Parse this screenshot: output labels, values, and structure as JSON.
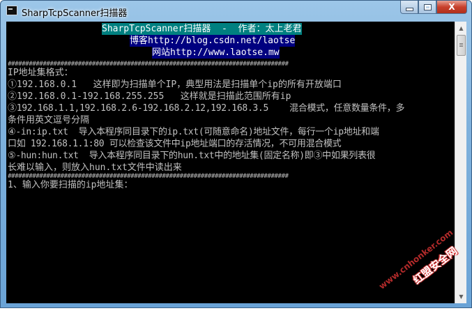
{
  "window": {
    "title": "SharpTcpScanner扫描器",
    "close_glyph": "X",
    "icons": {
      "app": "console-app-icon",
      "minimize": "minimize-icon",
      "maximize": "maximize-icon",
      "close": "close-icon"
    },
    "colors": {
      "title_bg": "#7fb1dc",
      "close_btn": "#c7402c",
      "console_bg": "#000000",
      "console_text": "#c0c0c0",
      "header_bg": "#008080",
      "link_bg": "#000080"
    }
  },
  "console": {
    "lines": [
      "SharpTcpScanner扫描器  -  作者：太上老君",
      "博客http://blog.csdn.net/laotse",
      "网站http://www.laotse.mw",
      "################################################################################",
      "IP地址集格式：",
      "①192.168.0.1   这样即为扫描单个IP，典型用法是扫描单个ip的所有开放端口",
      "②192.168.0.1-192.168.255.255   这样就是扫描此范围所有ip",
      "③192.168.1.1,192.168.2.6-192.168.2.12,192.168.3.5    混合模式，任意数量条件，多",
      "条件用英文逗号分隔",
      "④-in:ip.txt  导入本程序同目录下的ip.txt(可随意命名)地址文件，每行一个ip地址和端",
      "口如 192.168.1.1:80 可以检查该文件中ip地址端口的存活情况，不可用混合模式",
      "⑤-hun:hun.txt  导入本程序同目录下的hun.txt中的地址集(固定名称)即③中如果列表很",
      "长难以输入，则放入hun.txt文件中读出来",
      "################################################################################",
      "1、输入你要扫描的ip地址集："
    ]
  },
  "scrollbar": {
    "up_icon": "scroll-up-arrow-icon",
    "down_icon": "scroll-down-arrow-icon"
  },
  "watermark": {
    "line1": "www.cnhonker.com",
    "line2": "红盟安全网"
  }
}
